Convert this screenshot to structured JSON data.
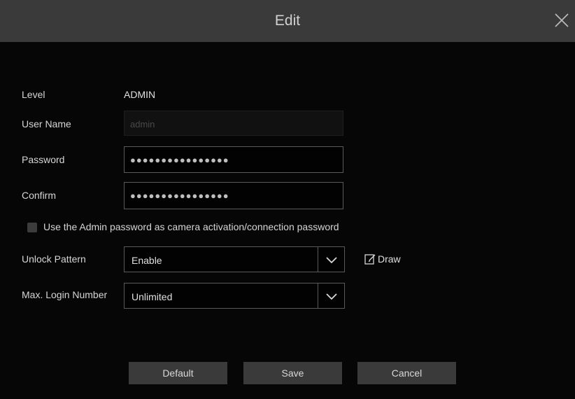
{
  "dialog": {
    "title": "Edit"
  },
  "form": {
    "level_label": "Level",
    "level_value": "ADMIN",
    "username_label": "User Name",
    "username_placeholder": "admin",
    "password_label": "Password",
    "password_value": "●●●●●●●●●●●●●●●●",
    "confirm_label": "Confirm",
    "confirm_value": "●●●●●●●●●●●●●●●●",
    "admin_password_checkbox_label": "Use the Admin password as camera activation/connection password",
    "admin_password_checked": false,
    "unlock_pattern_label": "Unlock Pattern",
    "unlock_pattern_value": "Enable",
    "draw_label": "Draw",
    "max_login_label": "Max. Login Number",
    "max_login_value": "Unlimited"
  },
  "buttons": {
    "default": "Default",
    "save": "Save",
    "cancel": "Cancel"
  },
  "icons": {
    "close": "close-icon",
    "dropdown": "chevron-down-icon",
    "draw": "edit-icon"
  }
}
